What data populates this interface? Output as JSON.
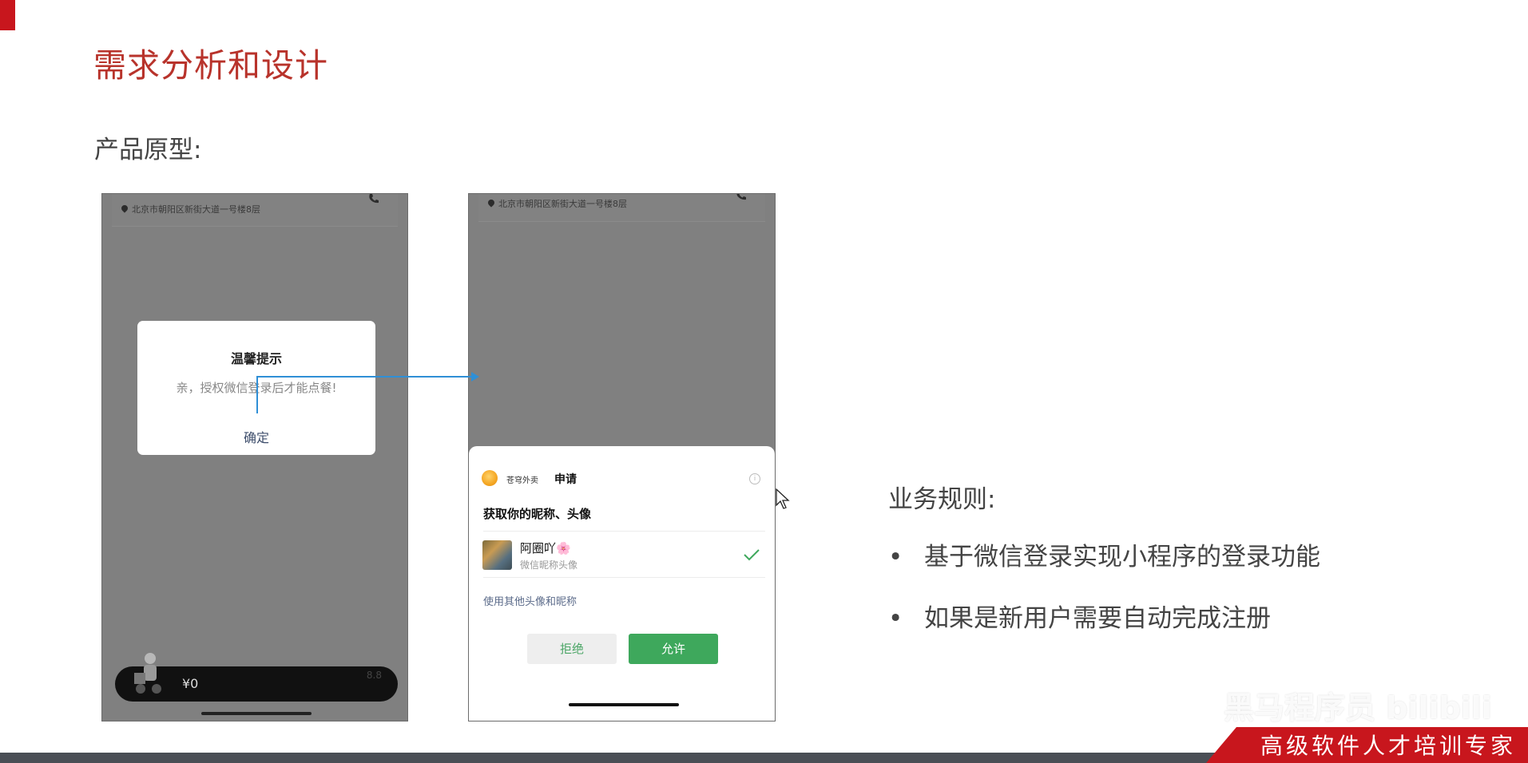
{
  "slide": {
    "title": "需求分析和设计",
    "subtitle": "产品原型:"
  },
  "prototype_left": {
    "address": "北京市朝阳区新街大道一号楼8层",
    "dialog_title": "温馨提示",
    "dialog_message": "亲，授权微信登录后才能点餐!",
    "dialog_confirm": "确定",
    "cart_price": "¥0",
    "cart_tag": "8.8"
  },
  "prototype_right": {
    "address": "北京市朝阳区新街大道一号楼8层",
    "app_name": "苍穹外卖",
    "apply_label": "申请",
    "request_text": "获取你的昵称、头像",
    "user_nickname": "阿圈吖🌸",
    "user_desc": "微信昵称头像",
    "other_link": "使用其他头像和昵称",
    "deny_button": "拒绝",
    "allow_button": "允许"
  },
  "rules": {
    "title": "业务规则:",
    "items": [
      "基于微信登录实现小程序的登录功能",
      "如果是新用户需要自动完成注册"
    ],
    "bullet": "•"
  },
  "footer": {
    "slogan": "高级软件人才培训专家",
    "watermark": "黑马程序员 bilibili"
  },
  "colors": {
    "title_red": "#b8332b",
    "brand_red": "#c8161d",
    "allow_green": "#3ea85c",
    "connector_blue": "#2f8fd6"
  }
}
